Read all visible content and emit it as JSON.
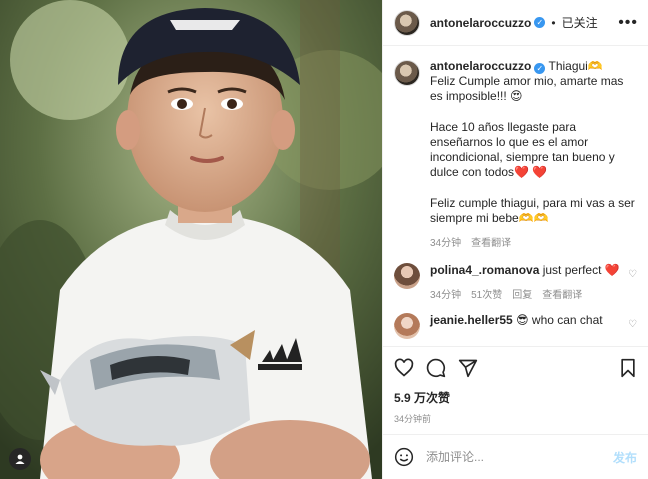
{
  "post": {
    "author": "antonelaroccuzzo",
    "follow_state": "已关注",
    "more": "•••"
  },
  "caption": {
    "author": "antonelaroccuzzo",
    "lead": "Thiagui🫶",
    "text": "Feliz Cumple amor mio, amarte mas es imposible!!! 😍\n\nHace 10 años llegaste para enseñarnos lo que es el amor incondicional, siempre tan bueno y dulce con todos❤️ ❤️\n\nFeliz cumple thiagui, para mi vas a ser siempre mi bebe🫶🫶",
    "time": "34分钟",
    "translate": "查看翻译"
  },
  "comments": [
    {
      "author": "polina4_.romanova",
      "text": "just perfect ❤️",
      "time": "34分钟",
      "likes": "51次赞",
      "reply": "回复",
      "translate": "查看翻译"
    },
    {
      "author": "jeanie.heller55",
      "text": "😎 who can chat"
    }
  ],
  "stats": {
    "likes": "5.9 万次赞",
    "time": "34分钟前"
  },
  "composer": {
    "placeholder": "添加评论...",
    "post_label": "发布"
  },
  "icons": [
    "heart-icon",
    "comment-icon",
    "share-icon",
    "bookmark-icon",
    "emoji-icon",
    "user-tag-icon"
  ],
  "colors": {
    "link": "#0095f6",
    "post_disabled": "#b2dffc",
    "heart": "#ed4956",
    "verified": "#3897f0"
  }
}
